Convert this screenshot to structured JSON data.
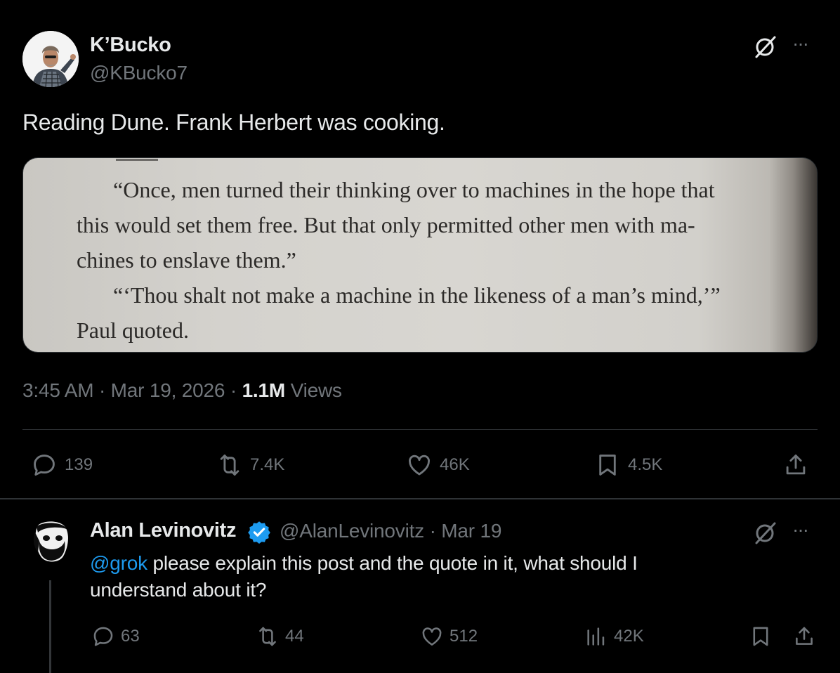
{
  "tweet": {
    "author_name": "K’Bucko",
    "author_handle": "@KBucko7",
    "text": "Reading Dune. Frank Herbert was cooking.",
    "image_quote": {
      "line1": "“Once, men turned their thinking over to machines in the hope that",
      "line2": "this would set them free. But that only permitted other men with ma-",
      "line3": "chines to enslave them.”",
      "line4": "“‘Thou shalt not make a machine in the likeness of a man’s mind,’”",
      "line5": "Paul quoted."
    },
    "time": "3:45 AM",
    "date": "Mar 19, 2026",
    "views_count": "1.1M",
    "views_label": "Views",
    "stats": {
      "replies": "139",
      "reposts": "7.4K",
      "likes": "46K",
      "bookmarks": "4.5K"
    }
  },
  "reply": {
    "author_name": "Alan Levinovitz",
    "author_handle": "@AlanLevinovitz",
    "date": "Mar 19",
    "mention": "@grok",
    "text_line1": " please explain this post and the quote in it, what should I",
    "text_line2": "understand about it?",
    "stats": {
      "replies": "63",
      "reposts": "44",
      "likes": "512",
      "views": "42K"
    }
  },
  "separators": {
    "dot": "·",
    "more": "···"
  },
  "colors": {
    "background": "#000000",
    "text_primary": "#e7e9ea",
    "text_secondary": "#71767b",
    "accent": "#1d9bf0",
    "border": "#2f3336"
  }
}
